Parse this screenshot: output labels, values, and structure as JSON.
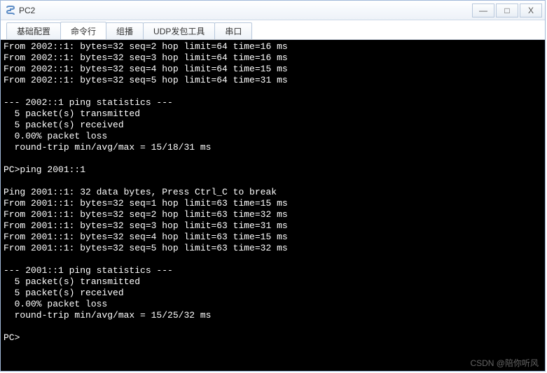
{
  "window": {
    "title": "PC2",
    "controls": {
      "minimize": "—",
      "maximize": "□",
      "close": "X"
    }
  },
  "tabs": {
    "items": [
      {
        "label": "基础配置"
      },
      {
        "label": "命令行"
      },
      {
        "label": "组播"
      },
      {
        "label": "UDP发包工具"
      },
      {
        "label": "串口"
      }
    ],
    "activeIndex": 1
  },
  "terminal": {
    "lines": [
      "From 2002::1: bytes=32 seq=2 hop limit=64 time=16 ms",
      "From 2002::1: bytes=32 seq=3 hop limit=64 time=16 ms",
      "From 2002::1: bytes=32 seq=4 hop limit=64 time=15 ms",
      "From 2002::1: bytes=32 seq=5 hop limit=64 time=31 ms",
      "",
      "--- 2002::1 ping statistics ---",
      "  5 packet(s) transmitted",
      "  5 packet(s) received",
      "  0.00% packet loss",
      "  round-trip min/avg/max = 15/18/31 ms",
      "",
      "PC>ping 2001::1",
      "",
      "Ping 2001::1: 32 data bytes, Press Ctrl_C to break",
      "From 2001::1: bytes=32 seq=1 hop limit=63 time=15 ms",
      "From 2001::1: bytes=32 seq=2 hop limit=63 time=32 ms",
      "From 2001::1: bytes=32 seq=3 hop limit=63 time=31 ms",
      "From 2001::1: bytes=32 seq=4 hop limit=63 time=15 ms",
      "From 2001::1: bytes=32 seq=5 hop limit=63 time=32 ms",
      "",
      "--- 2001::1 ping statistics ---",
      "  5 packet(s) transmitted",
      "  5 packet(s) received",
      "  0.00% packet loss",
      "  round-trip min/avg/max = 15/25/32 ms",
      "",
      "PC>"
    ]
  },
  "watermark": "CSDN @陪你听风"
}
